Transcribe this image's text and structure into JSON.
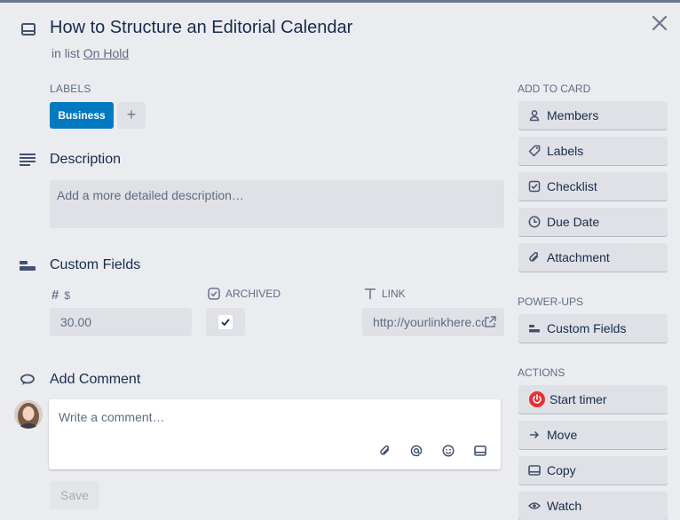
{
  "card": {
    "title": "How to Structure an Editorial Calendar",
    "in_list_prefix": "in list",
    "list_name": "On Hold"
  },
  "labels": {
    "heading": "LABELS",
    "items": [
      {
        "name": "Business",
        "color": "#0079bf"
      }
    ],
    "add_symbol": "+"
  },
  "description": {
    "heading": "Description",
    "placeholder": "Add a more detailed description…"
  },
  "custom_fields": {
    "heading": "Custom Fields",
    "fields": [
      {
        "icon": "number-icon",
        "label": "$",
        "value": "30.00"
      },
      {
        "icon": "checkbox-icon",
        "label": "ARCHIVED",
        "checked": true
      },
      {
        "icon": "text-icon",
        "label": "LINK",
        "value": "http://yourlinkhere.com"
      }
    ]
  },
  "comment": {
    "heading": "Add Comment",
    "placeholder": "Write a comment…",
    "save_label": "Save",
    "tools": [
      "attachment-icon",
      "mention-icon",
      "emoji-icon",
      "card-icon"
    ]
  },
  "sidebar": {
    "add_to_card": {
      "heading": "ADD TO CARD",
      "items": [
        {
          "label": "Members",
          "icon": "person-icon"
        },
        {
          "label": "Labels",
          "icon": "tag-icon"
        },
        {
          "label": "Checklist",
          "icon": "checklist-icon"
        },
        {
          "label": "Due Date",
          "icon": "clock-icon"
        },
        {
          "label": "Attachment",
          "icon": "paperclip-icon"
        }
      ]
    },
    "power_ups": {
      "heading": "POWER-UPS",
      "items": [
        {
          "label": "Custom Fields",
          "icon": "custom-fields-icon"
        }
      ]
    },
    "actions": {
      "heading": "ACTIONS",
      "items": [
        {
          "label": "Start timer",
          "icon": "power-icon"
        },
        {
          "label": "Move",
          "icon": "arrow-right-icon"
        },
        {
          "label": "Copy",
          "icon": "card-icon"
        },
        {
          "label": "Watch",
          "icon": "eye-icon"
        }
      ]
    }
  },
  "colors": {
    "accent": "#0079bf",
    "background": "#ebecf0",
    "timer_red": "#eb2f2f"
  }
}
